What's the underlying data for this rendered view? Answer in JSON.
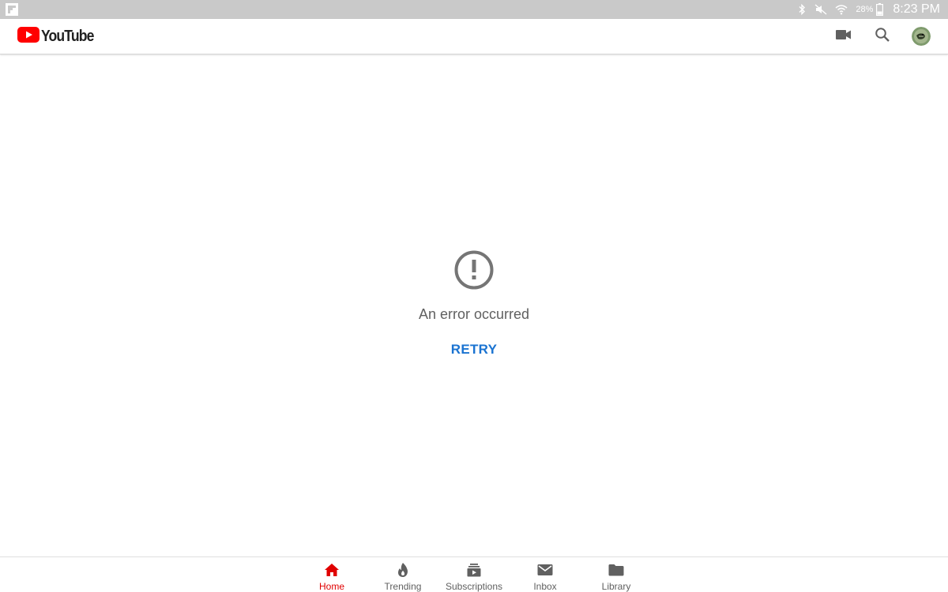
{
  "status_bar": {
    "battery_percent": "28%",
    "time": "8:23 PM"
  },
  "header": {
    "logo_text": "YouTube",
    "icons": [
      "video-camera-icon",
      "search-icon"
    ],
    "brand_color": "#ff0000"
  },
  "error": {
    "icon": "exclamation-circle-icon",
    "message": "An error occurred",
    "retry_label": "RETRY",
    "retry_color": "#1a73d1"
  },
  "bottom_nav": {
    "active_color": "#e00000",
    "items": [
      {
        "label": "Home",
        "icon": "home-icon",
        "active": true
      },
      {
        "label": "Trending",
        "icon": "flame-icon",
        "active": false
      },
      {
        "label": "Subscriptions",
        "icon": "subscriptions-icon",
        "active": false
      },
      {
        "label": "Inbox",
        "icon": "mail-icon",
        "active": false
      },
      {
        "label": "Library",
        "icon": "folder-icon",
        "active": false
      }
    ]
  }
}
